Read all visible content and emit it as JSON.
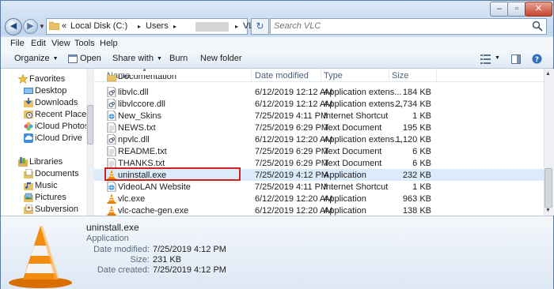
{
  "window": {
    "controls": {
      "minimize": "–",
      "maximize": "▫",
      "close": "✕"
    }
  },
  "address": {
    "crumbs": [
      "«",
      "Local Disk (C:)",
      "▸",
      "Users",
      "▸",
      "VLC",
      "▸"
    ],
    "search_placeholder": "Search VLC"
  },
  "menu": [
    "File",
    "Edit",
    "View",
    "Tools",
    "Help"
  ],
  "toolbar": {
    "organize": "Organize",
    "open": "Open",
    "share_with": "Share with",
    "burn": "Burn",
    "new_folder": "New folder"
  },
  "nav": {
    "favorites_label": "Favorites",
    "favorites": [
      "Desktop",
      "Downloads",
      "Recent Places",
      "iCloud Photos",
      "iCloud Drive"
    ],
    "libraries_label": "Libraries",
    "libraries": [
      "Documents",
      "Music",
      "Pictures",
      "Subversion"
    ]
  },
  "columns": {
    "name": "Name",
    "date": "Date modified",
    "type": "Type",
    "size": "Size"
  },
  "files": [
    {
      "name": "Documentation",
      "date": "",
      "type": "",
      "size": "",
      "icon": "folder-icon"
    },
    {
      "name": "libvlc.dll",
      "date": "6/12/2019 12:12 AM",
      "type": "Application extens...",
      "size": "184 KB",
      "icon": "dll-icon"
    },
    {
      "name": "libvlccore.dll",
      "date": "6/12/2019 12:12 AM",
      "type": "Application extens...",
      "size": "2,734 KB",
      "icon": "dll-icon"
    },
    {
      "name": "New_Skins",
      "date": "7/25/2019 4:11 PM",
      "type": "Internet Shortcut",
      "size": "1 KB",
      "icon": "internet-shortcut-icon"
    },
    {
      "name": "NEWS.txt",
      "date": "7/25/2019 6:29 PM",
      "type": "Text Document",
      "size": "195 KB",
      "icon": "text-file-icon"
    },
    {
      "name": "npvlc.dll",
      "date": "6/12/2019 12:20 AM",
      "type": "Application extens...",
      "size": "1,120 KB",
      "icon": "dll-icon"
    },
    {
      "name": "README.txt",
      "date": "7/25/2019 6:29 PM",
      "type": "Text Document",
      "size": "6 KB",
      "icon": "text-file-icon"
    },
    {
      "name": "THANKS.txt",
      "date": "7/25/2019 6:29 PM",
      "type": "Text Document",
      "size": "6 KB",
      "icon": "text-file-icon"
    },
    {
      "name": "uninstall.exe",
      "date": "7/25/2019 4:12 PM",
      "type": "Application",
      "size": "232 KB",
      "icon": "vlc-cone-icon"
    },
    {
      "name": "VideoLAN Website",
      "date": "7/25/2019 4:11 PM",
      "type": "Internet Shortcut",
      "size": "1 KB",
      "icon": "internet-shortcut-icon"
    },
    {
      "name": "vlc.exe",
      "date": "6/12/2019 12:20 AM",
      "type": "Application",
      "size": "963 KB",
      "icon": "vlc-cone-icon"
    },
    {
      "name": "vlc-cache-gen.exe",
      "date": "6/12/2019 12:20 AM",
      "type": "Application",
      "size": "138 KB",
      "icon": "vlc-cone-icon"
    }
  ],
  "details": {
    "filename": "uninstall.exe",
    "filetype": "Application",
    "date_modified_label": "Date modified:",
    "date_modified": "7/25/2019 4:12 PM",
    "size_label": "Size:",
    "size": "231 KB",
    "date_created_label": "Date created:",
    "date_created": "7/25/2019 4:12 PM"
  },
  "colors": {
    "selection": "#dcebfc",
    "highlight_outline": "#d02020",
    "vlc_orange": "#f08a00"
  }
}
